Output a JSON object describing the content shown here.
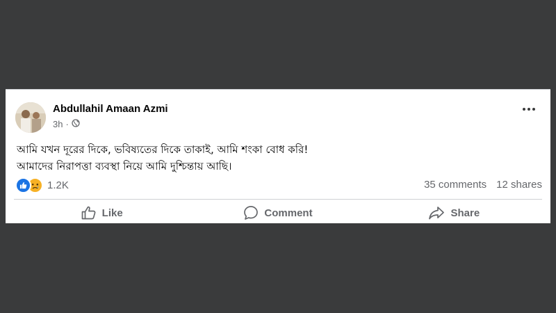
{
  "post": {
    "author": "Abdullahil Amaan Azmi",
    "time": "3h",
    "audience_icon": "globe-icon",
    "text_lines": [
      "আমি যখন দূরের দিকে, ভবিষ্যতের দিকে তাকাই, আমি শংকা বোধ করি!",
      "আমাদের নিরাপত্তা ব্যবস্থা নিয়ে আমি দুশ্চিন্তায় আছি।"
    ],
    "reactions": {
      "icons": [
        "like-reaction-icon",
        "sad-reaction-icon"
      ],
      "count": "1.2K"
    },
    "comments": "35 comments",
    "shares": "12 shares",
    "actions": {
      "like": "Like",
      "comment": "Comment",
      "share": "Share"
    },
    "colors": {
      "like_blue": "#1b74e4",
      "sad_yellow": "#f7b125",
      "secondary_text": "#65676b",
      "background": "#3a3b3c"
    }
  }
}
